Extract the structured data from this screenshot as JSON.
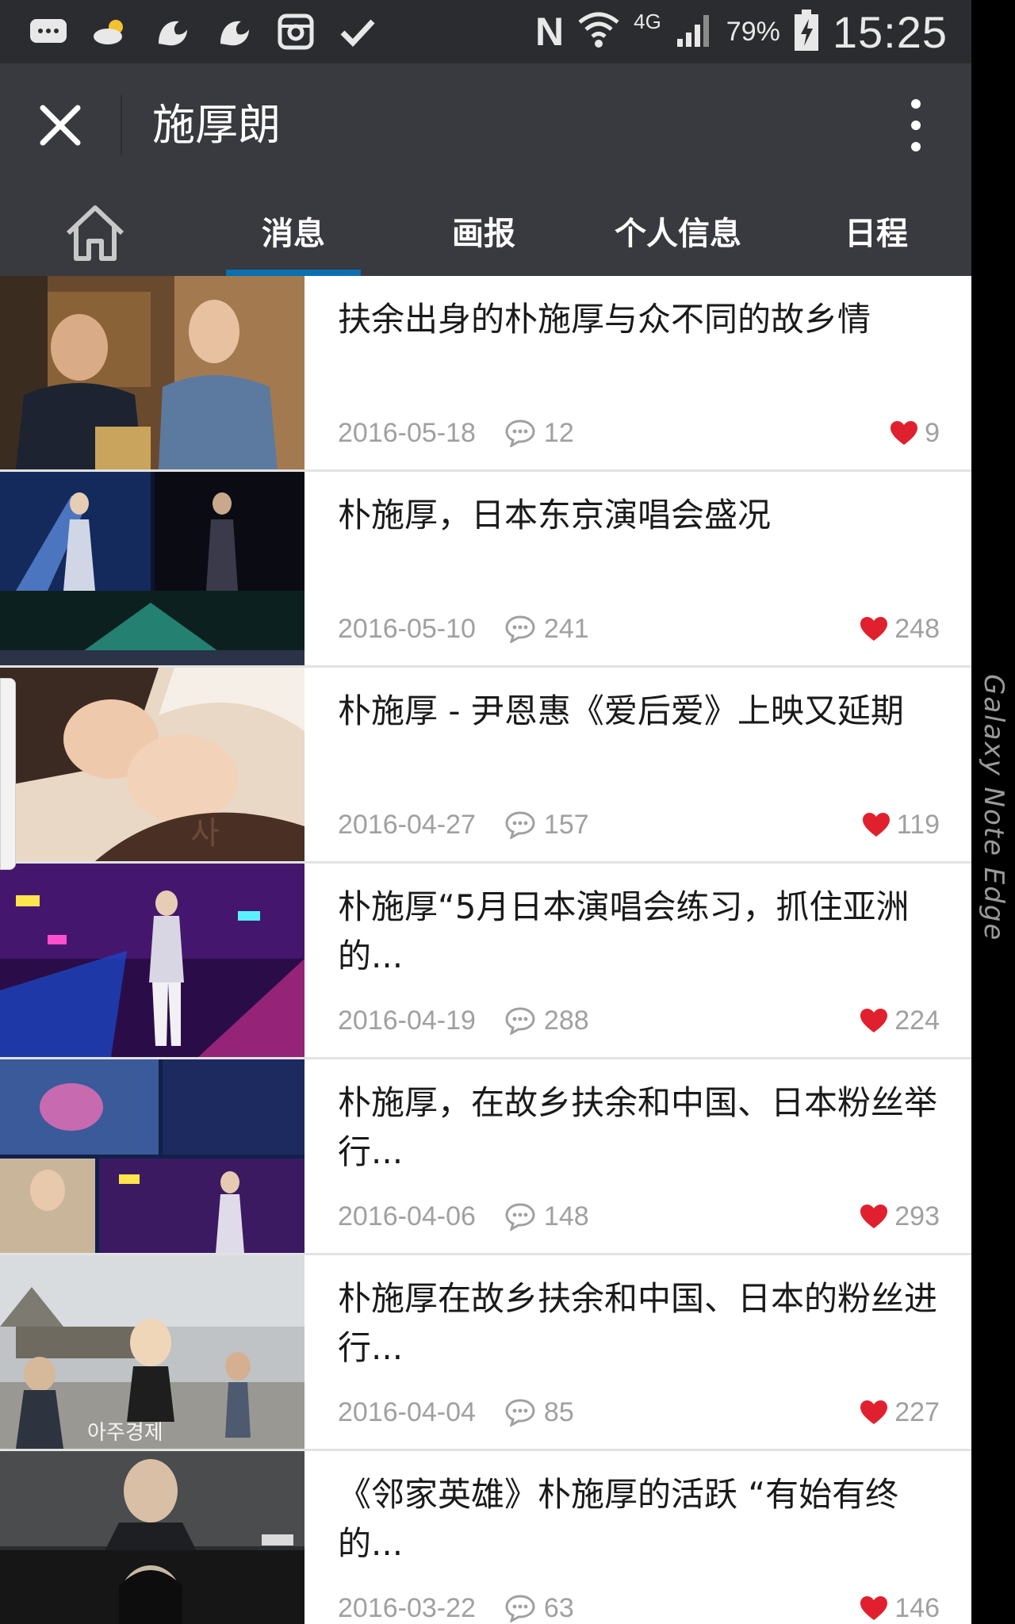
{
  "status_bar": {
    "icons": [
      "message-icon",
      "weather-icon",
      "uc-browser-icon",
      "uc-browser-icon",
      "instagram-icon",
      "check-icon"
    ],
    "nfc_label": "N",
    "network": "4G",
    "battery": "79%",
    "time": "15:25"
  },
  "header": {
    "title": "施厚朗"
  },
  "tabs": {
    "home_icon": "home-icon",
    "items": [
      {
        "label": "消息"
      },
      {
        "label": "画报"
      },
      {
        "label": "个人信息"
      },
      {
        "label": "日程"
      }
    ],
    "active_index": 0
  },
  "articles": [
    {
      "title": "扶余出身的朴施厚与众不同的故乡情",
      "date": "2016-05-18",
      "comments": "12",
      "likes": "9"
    },
    {
      "title": "朴施厚，日本东京演唱会盛况",
      "date": "2016-05-10",
      "comments": "241",
      "likes": "248"
    },
    {
      "title": "朴施厚 - 尹恩惠《爱后爱》上映又延期",
      "date": "2016-04-27",
      "comments": "157",
      "likes": "119"
    },
    {
      "title": "朴施厚“5月日本演唱会练习，抓住亚洲的...",
      "date": "2016-04-19",
      "comments": "288",
      "likes": "224"
    },
    {
      "title": "朴施厚，在故乡扶余和中国、日本粉丝举行...",
      "date": "2016-04-06",
      "comments": "148",
      "likes": "293"
    },
    {
      "title": "朴施厚在故乡扶余和中国、日本的粉丝进行...",
      "date": "2016-04-04",
      "comments": "85",
      "likes": "227"
    },
    {
      "title": "《邻家英雄》朴施厚的活跃 “有始有终的...",
      "date": "2016-03-22",
      "comments": "63",
      "likes": "146"
    }
  ],
  "edge_panel": {
    "label": "Galaxy Note Edge"
  },
  "colors": {
    "header_bg": "#393a3f",
    "status_bg": "#2b2c2f",
    "tab_indicator": "#0b6fb0",
    "heart": "#e0202e",
    "meta_text": "#a0a0a0"
  }
}
